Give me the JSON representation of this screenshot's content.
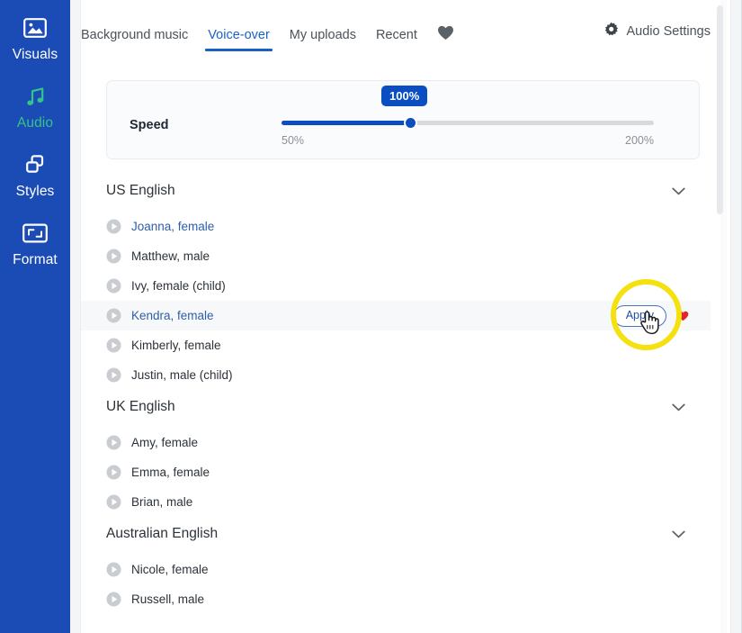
{
  "sidebar": {
    "items": [
      {
        "label": "Visuals",
        "icon": "image-icon",
        "active": false
      },
      {
        "label": "Audio",
        "icon": "music-note-icon",
        "active": true
      },
      {
        "label": "Styles",
        "icon": "layers-icon",
        "active": false
      },
      {
        "label": "Format",
        "icon": "crop-frame-icon",
        "active": false
      }
    ],
    "bg_color": "#1b4bb5",
    "active_color": "#34c48a"
  },
  "tabs": [
    {
      "label": "Background music",
      "active": false
    },
    {
      "label": "Voice-over",
      "active": true
    },
    {
      "label": "My uploads",
      "active": false
    },
    {
      "label": "Recent",
      "active": false
    }
  ],
  "favorites_tab": {
    "icon": "heart-icon"
  },
  "audio_settings": {
    "label": "Audio Settings",
    "icon": "gear-icon"
  },
  "speed": {
    "label": "Speed",
    "value_badge": "100%",
    "min_label": "50%",
    "max_label": "200%",
    "accent_color": "#0b4ec2"
  },
  "groups": [
    {
      "title": "US English",
      "chevron": "chevron-down-icon",
      "voices": [
        {
          "name": "Joanna, female",
          "selected": true,
          "highlight": false,
          "apply": null,
          "favorite": false
        },
        {
          "name": "Matthew, male",
          "selected": false,
          "highlight": false,
          "apply": null,
          "favorite": false
        },
        {
          "name": "Ivy, female (child)",
          "selected": false,
          "highlight": false,
          "apply": null,
          "favorite": false
        },
        {
          "name": "Kendra, female",
          "selected": true,
          "highlight": true,
          "apply": "Apply",
          "favorite": true
        },
        {
          "name": "Kimberly, female",
          "selected": false,
          "highlight": false,
          "apply": null,
          "favorite": false
        },
        {
          "name": "Justin, male (child)",
          "selected": false,
          "highlight": false,
          "apply": null,
          "favorite": false
        }
      ]
    },
    {
      "title": "UK English",
      "chevron": "chevron-down-icon",
      "voices": [
        {
          "name": "Amy, female",
          "selected": false,
          "highlight": false,
          "apply": null,
          "favorite": false
        },
        {
          "name": "Emma, female",
          "selected": false,
          "highlight": false,
          "apply": null,
          "favorite": false
        },
        {
          "name": "Brian, male",
          "selected": false,
          "highlight": false,
          "apply": null,
          "favorite": false
        }
      ]
    },
    {
      "title": "Australian English",
      "chevron": "chevron-down-icon",
      "voices": [
        {
          "name": "Nicole, female",
          "selected": false,
          "highlight": false,
          "apply": null,
          "favorite": false
        },
        {
          "name": "Russell, male",
          "selected": false,
          "highlight": false,
          "apply": null,
          "favorite": false
        }
      ]
    }
  ],
  "annotation": {
    "shape": "circle",
    "color": "#f5e010"
  },
  "cursor": {
    "type": "pointing-hand-cursor"
  }
}
